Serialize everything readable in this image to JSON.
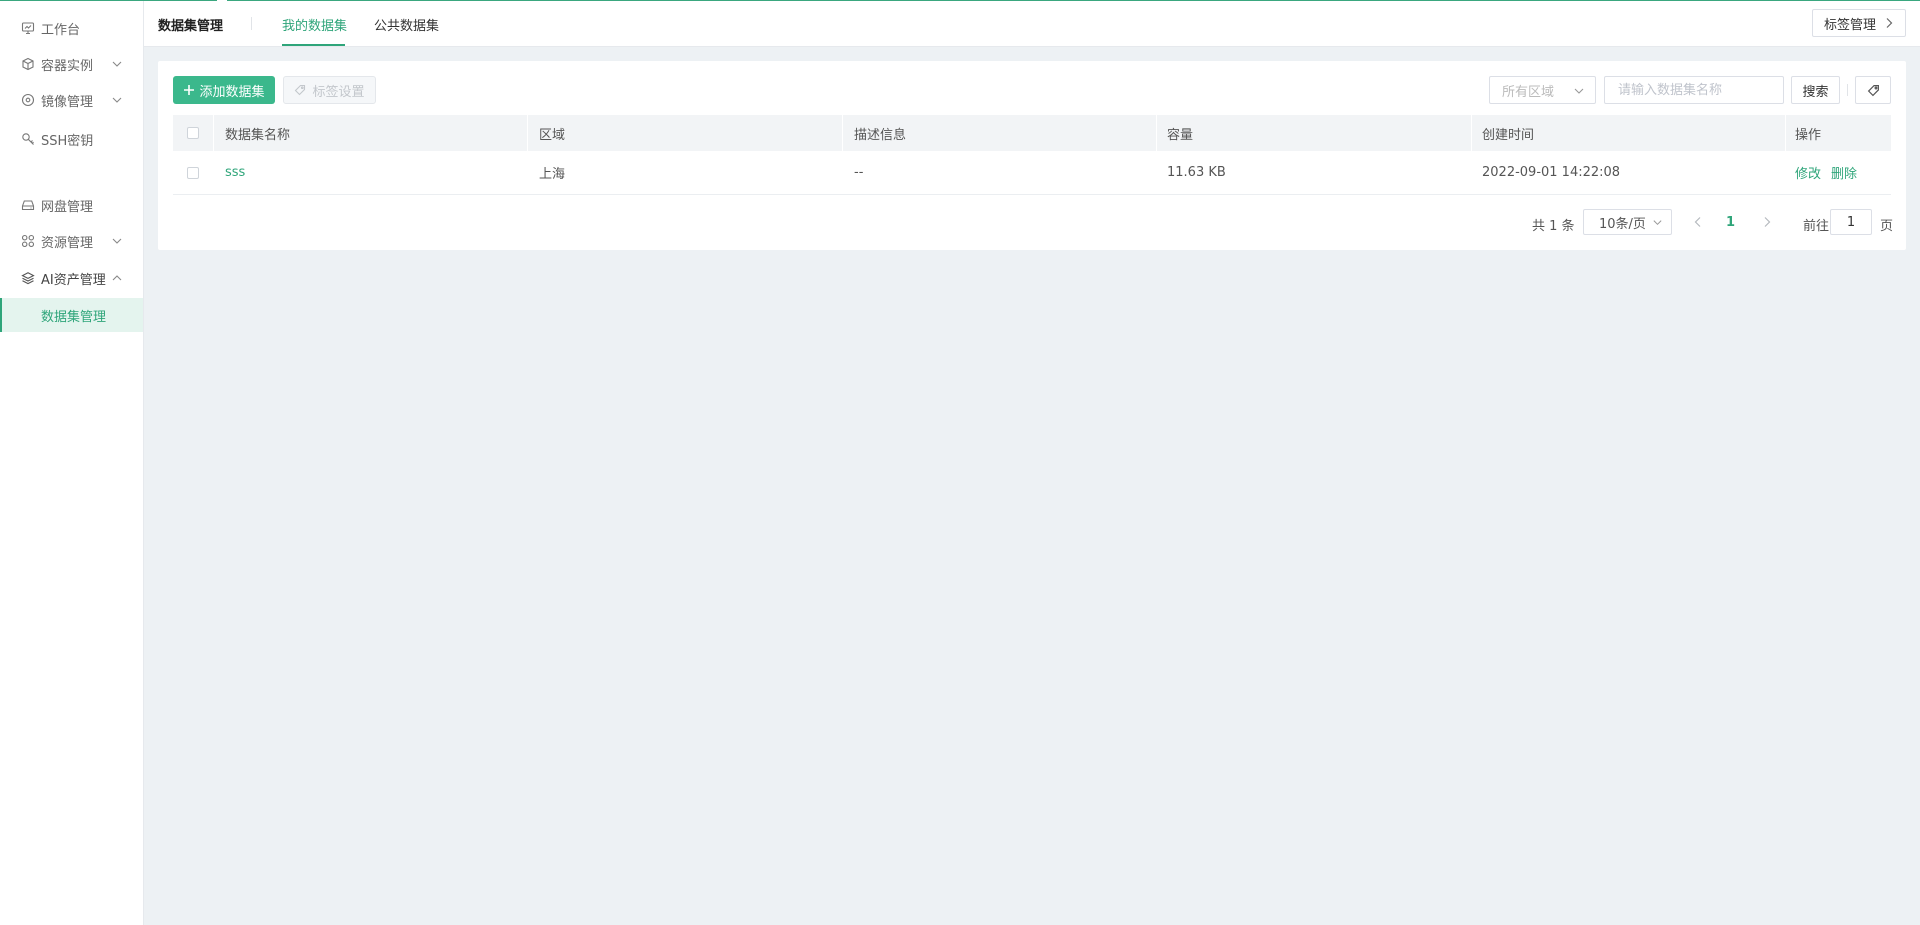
{
  "sidebar": {
    "items": [
      {
        "label": "工作台",
        "icon": "dashboard-icon"
      },
      {
        "label": "容器实例",
        "icon": "cube-icon",
        "expandable": true
      },
      {
        "label": "镜像管理",
        "icon": "disc-icon",
        "expandable": true
      },
      {
        "label": "SSH密钥",
        "icon": "key-icon"
      },
      {
        "label": "网盘管理",
        "icon": "drive-icon"
      },
      {
        "label": "资源管理",
        "icon": "grid-icon",
        "expandable": true
      },
      {
        "label": "AI资产管理",
        "icon": "layers-icon",
        "expanded": true
      }
    ],
    "sub_items": [
      {
        "label": "数据集管理",
        "active": true
      }
    ]
  },
  "header": {
    "title": "数据集管理",
    "tabs": [
      {
        "label": "我的数据集",
        "active": true
      },
      {
        "label": "公共数据集",
        "active": false
      }
    ],
    "tag_manage_label": "标签管理"
  },
  "toolbar": {
    "add_label": "添加数据集",
    "tag_settings_label": "标签设置",
    "region_select": "所有区域",
    "search_placeholder": "请输入数据集名称",
    "search_label": "搜索"
  },
  "table": {
    "columns": [
      "数据集名称",
      "区域",
      "描述信息",
      "容量",
      "创建时间",
      "操作"
    ],
    "rows": [
      {
        "name": "sss",
        "region": "上海",
        "description": "--",
        "capacity": "11.63 KB",
        "created": "2022-09-01 14:22:08",
        "actions": [
          "修改",
          "删除"
        ]
      }
    ]
  },
  "pagination": {
    "total": "共 1 条",
    "page_size": "10条/页",
    "current_page": "1",
    "goto_label": "前往",
    "goto_value": "1",
    "page_suffix": "页"
  },
  "colors": {
    "accent": "#2fa57a",
    "primary_button": "#3bb88c",
    "background": "#edf1f4"
  }
}
